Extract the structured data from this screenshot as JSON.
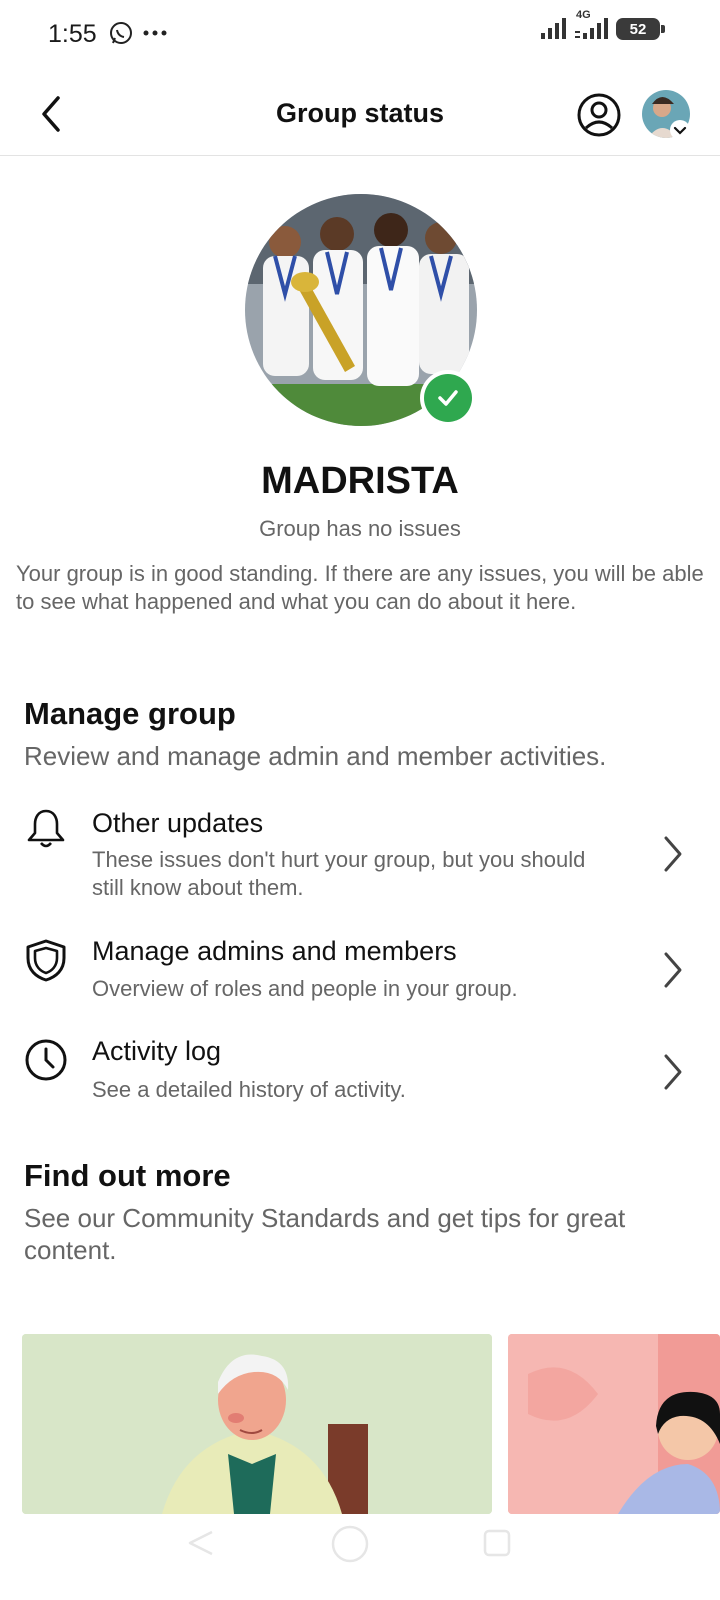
{
  "status_bar": {
    "time": "1:55",
    "network": "4G",
    "battery": "52"
  },
  "header": {
    "title": "Group status"
  },
  "group": {
    "name": "MADRISTA",
    "status": "Group has no issues",
    "description": "Your group is in good standing. If there are any issues, you will be able to see what happened and what you can do about it here."
  },
  "manage": {
    "title": "Manage group",
    "subtitle": "Review and manage admin and member activities.",
    "items": [
      {
        "icon": "bell-icon",
        "title": "Other updates",
        "subtitle": "These issues don't hurt your group, but you should still know about them."
      },
      {
        "icon": "shield-icon",
        "title": "Manage admins and members",
        "subtitle": "Overview of roles and people in your group."
      },
      {
        "icon": "clock-icon",
        "title": "Activity log",
        "subtitle": "See a detailed history of activity."
      }
    ]
  },
  "find_out": {
    "title": "Find out more",
    "subtitle": "See our Community Standards and get tips for great content."
  },
  "colors": {
    "verified": "#2fa84f",
    "secondary_text": "#666666",
    "card_1_bg": "#d8e6c8",
    "card_2_bg": "#f6b7b2"
  }
}
